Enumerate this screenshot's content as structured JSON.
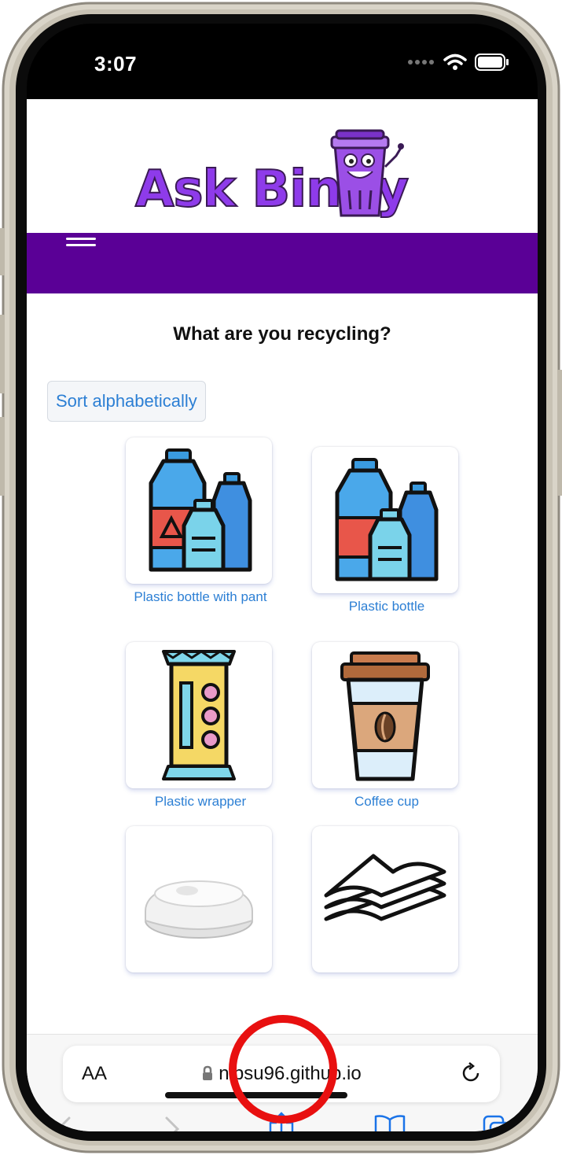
{
  "status": {
    "time": "3:07"
  },
  "site": {
    "logo_text": "Ask Binny",
    "question": "What are you recycling?",
    "sort_button": "Sort alphabetically",
    "items": [
      {
        "label": "Plastic bottle with pant",
        "icon": "plastic-bottle-pant-icon"
      },
      {
        "label": "Plastic bottle",
        "icon": "plastic-bottle-icon"
      },
      {
        "label": "Plastic wrapper",
        "icon": "plastic-wrapper-icon"
      },
      {
        "label": "Coffee cup",
        "icon": "coffee-cup-icon"
      },
      {
        "label": "",
        "icon": "cup-lid-icon"
      },
      {
        "label": "",
        "icon": "napkins-icon"
      }
    ]
  },
  "browser": {
    "text_size_label": "AA",
    "url": "nipsu96.github.io"
  },
  "colors": {
    "navbar": "#5a0096",
    "link": "#2c7fd4",
    "logo": "#8e3bea",
    "highlight": "#e81010"
  }
}
